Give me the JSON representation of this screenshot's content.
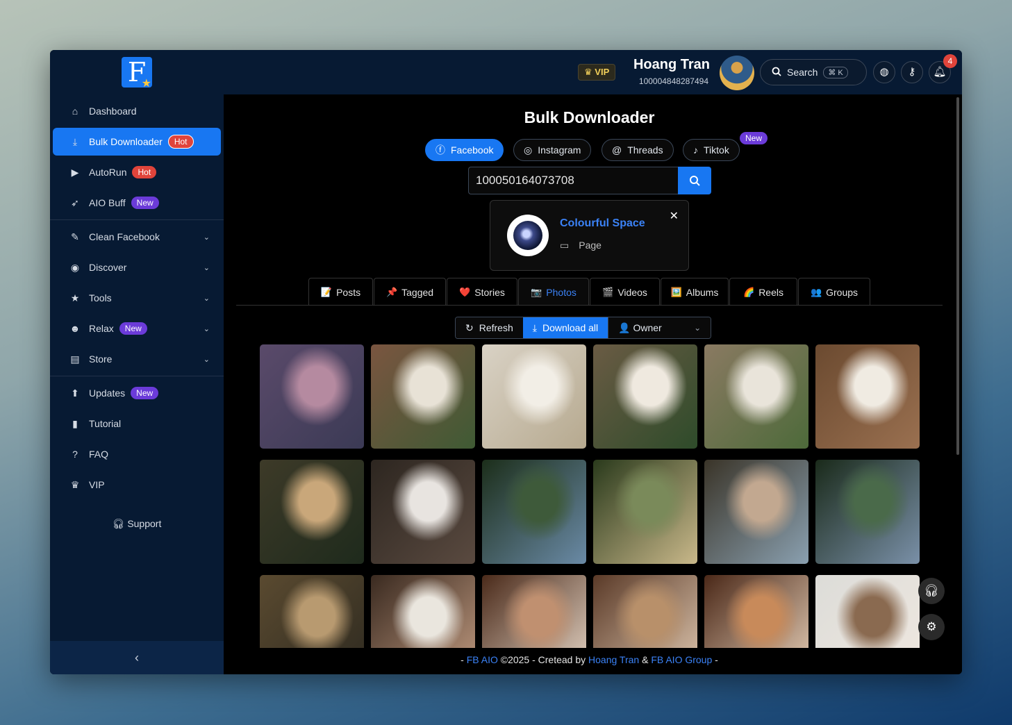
{
  "sidebar": {
    "logo_letter": "F",
    "items": [
      {
        "label": "Dashboard",
        "icon": "home-icon",
        "badge": ""
      },
      {
        "label": "Bulk Downloader",
        "icon": "download-icon",
        "badge": "Hot"
      },
      {
        "label": "AutoRun",
        "icon": "play-icon",
        "badge": "Hot"
      },
      {
        "label": "AIO Buff",
        "icon": "rocket-icon",
        "badge": "New"
      },
      {
        "label": "Clean Facebook",
        "icon": "broom-icon",
        "badge": ""
      },
      {
        "label": "Discover",
        "icon": "eye-icon",
        "badge": ""
      },
      {
        "label": "Tools",
        "icon": "star-icon",
        "badge": ""
      },
      {
        "label": "Relax",
        "icon": "smile-icon",
        "badge": "New"
      },
      {
        "label": "Store",
        "icon": "store-icon",
        "badge": ""
      },
      {
        "label": "Updates",
        "icon": "arrow-up-circle-icon",
        "badge": "New"
      },
      {
        "label": "Tutorial",
        "icon": "book-icon",
        "badge": ""
      },
      {
        "label": "FAQ",
        "icon": "question-circle-icon",
        "badge": ""
      },
      {
        "label": "VIP",
        "icon": "crown-icon",
        "badge": ""
      }
    ],
    "support_label": "Support",
    "collapse_icon": "‹"
  },
  "header": {
    "vip_label": "VIP",
    "user_name": "Hoang Tran",
    "user_id": "100004848287494",
    "search_label": "Search",
    "search_shortcut": "⌘ K",
    "notification_count": "4"
  },
  "main": {
    "title": "Bulk Downloader",
    "platform_tabs": [
      {
        "label": "Facebook",
        "icon": "facebook-icon"
      },
      {
        "label": "Instagram",
        "icon": "instagram-icon"
      },
      {
        "label": "Threads",
        "icon": "threads-icon"
      },
      {
        "label": "Tiktok",
        "icon": "tiktok-icon"
      }
    ],
    "tiktok_badge": "New",
    "id_input_value": "100050164073708",
    "result": {
      "name": "Colourful Space",
      "type": "Page"
    },
    "content_tabs": [
      {
        "label": "Posts",
        "icon": "📝"
      },
      {
        "label": "Tagged",
        "icon": "📌"
      },
      {
        "label": "Stories",
        "icon": "❤️"
      },
      {
        "label": "Photos",
        "icon": "📷"
      },
      {
        "label": "Videos",
        "icon": "🎬"
      },
      {
        "label": "Albums",
        "icon": "🖼️"
      },
      {
        "label": "Reels",
        "icon": "🌈"
      },
      {
        "label": "Groups",
        "icon": "👥"
      }
    ],
    "actions": {
      "refresh": "Refresh",
      "download_all": "Download all",
      "owner": "Owner"
    },
    "photos": [
      {
        "colors": [
          "#5a4a6a",
          "#b58aa0",
          "#3b3a55"
        ]
      },
      {
        "colors": [
          "#7a5540",
          "#e8e2d6",
          "#3f5a34"
        ]
      },
      {
        "colors": [
          "#d9d2c5",
          "#f2eee6",
          "#b6a98f"
        ]
      },
      {
        "colors": [
          "#6a5b44",
          "#efe9df",
          "#2e4b2a"
        ]
      },
      {
        "colors": [
          "#8a7a62",
          "#e9e4da",
          "#4d6a3a"
        ]
      },
      {
        "colors": [
          "#6b4a30",
          "#f0ebe2",
          "#9a7050"
        ]
      },
      {
        "colors": [
          "#3d3a28",
          "#c9a77a",
          "#1e2a1c"
        ]
      },
      {
        "colors": [
          "#2d2620",
          "#e8e4e0",
          "#5a4a40"
        ]
      },
      {
        "colors": [
          "#1c2e1a",
          "#3e5a3a",
          "#6a8aa6"
        ]
      },
      {
        "colors": [
          "#2a3a1c",
          "#7a8a5a",
          "#c9b88a"
        ]
      },
      {
        "colors": [
          "#3a3428",
          "#c2a890",
          "#8aa0b0"
        ]
      },
      {
        "colors": [
          "#1a2a1a",
          "#4a6a4a",
          "#7a90a8"
        ]
      },
      {
        "colors": [
          "#5a4a30",
          "#b89a70",
          "#2e2a20"
        ]
      },
      {
        "colors": [
          "#3a2a20",
          "#eae6de",
          "#c09a80"
        ]
      },
      {
        "colors": [
          "#4a2a1a",
          "#c09070",
          "#e8d8c8"
        ]
      },
      {
        "colors": [
          "#5a3a28",
          "#b8906a",
          "#e0c8b0"
        ]
      },
      {
        "colors": [
          "#4a2818",
          "#c88a5a",
          "#e8d0b8"
        ]
      },
      {
        "colors": [
          "#dcdcd8",
          "#8a6a50",
          "#f0e8e0"
        ]
      }
    ]
  },
  "footer": {
    "dash_left": "- ",
    "fb_aio": "FB AIO",
    "copyright": " ©2025 - Cretead by ",
    "author": "Hoang Tran",
    "amp": " & ",
    "group": "FB AIO Group",
    "dash_right": " -"
  },
  "colors": {
    "accent": "#1877f2",
    "sidebar_bg": "#071a33",
    "hot": "#e0443b",
    "new": "#6b3bd9"
  }
}
